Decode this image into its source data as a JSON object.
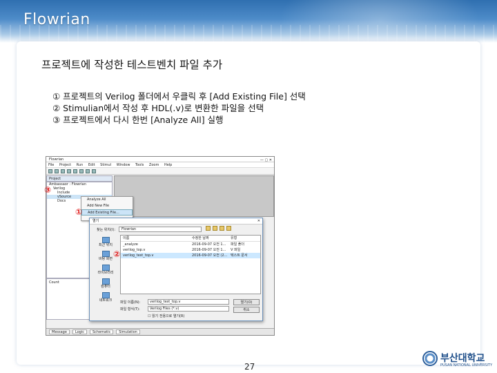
{
  "header": {
    "title": "Flowrian"
  },
  "slide": {
    "subtitle": "프로젝트에 작성한 테스트벤치 파일 추가",
    "steps": [
      "① 프로젝트의 Verilog 폴더에서 우클릭 후 [Add Existing File] 선택",
      "② Stimulian에서 작성 후 HDL(.v)로 변환한 파일을 선택",
      "③ 프로젝트에서 다시 한번 [Analyze All] 실행"
    ],
    "page_number": "27"
  },
  "markers": [
    "③",
    "①",
    "②"
  ],
  "screenshot": {
    "window_title": "Flowrian",
    "menu": [
      "File",
      "Project",
      "Run",
      "Edit",
      "Stimul",
      "Window",
      "Tools",
      "Zoom",
      "Help"
    ],
    "project_tab": "Project",
    "tree": [
      "Ambassaor : Flowrian",
      "Verilog",
      "Include",
      "vSource",
      "Docs"
    ],
    "context_menu": [
      "Analyze All",
      "Add New File",
      "Add Existing File..."
    ],
    "dialog": {
      "title": "열기",
      "look_in_label": "찾는 위치(I):",
      "look_in_value": "Flowrian",
      "places": [
        "최근 위치",
        "바탕 화면",
        "라이브러리",
        "컴퓨터",
        "네트워크"
      ],
      "columns": [
        "이름",
        "수정한 날짜",
        "유형"
      ],
      "files": [
        {
          "name": "_analyze",
          "date": "2016-09-07 오전 1...",
          "type": "파일 폴더"
        },
        {
          "name": "verilog_top.v",
          "date": "2016-09-07 오전 1...",
          "type": "V 파일"
        },
        {
          "name": "verilog_test_top.v",
          "date": "2016-09-07 오전 (2...",
          "type": "텍스트 문서"
        }
      ],
      "filename_label": "파일 이름(N):",
      "filename_value": "verilog_test_top.v",
      "filetype_label": "파일 형식(T):",
      "filetype_value": "Verilog Files (*.v)",
      "readonly_label": "읽기 전용으로 열기(R)",
      "open_button": "열기(O)",
      "cancel_button": "취소"
    },
    "status_tabs": [
      "Message",
      "Logic",
      "Schematic",
      "Simulation"
    ],
    "console_label": "Count"
  },
  "logo": {
    "name": "부산대학교",
    "sub": "PUSAN NATIONAL UNIVERSITY"
  }
}
